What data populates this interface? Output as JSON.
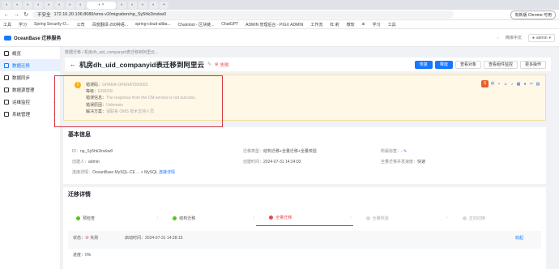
{
  "browser": {
    "address": "172.16.20.106:8089/oms-v2/migration/np_Sy5hk2invkw0",
    "not_secure": "不安全",
    "chrome_button": "有新版 Chrome 可用",
    "bookmarks": [
      "工具",
      "学习",
      "Spring Security-O...",
      "公司",
      "百度翻译-200种语...",
      "spring-cloud-aliba...",
      "Chaintool - 区块链...",
      "ChatGPT",
      "ADMIN 管理后台 - PIGX ADMIN",
      "工作流",
      "杠 莉",
      "微软",
      "ai",
      "学习",
      "工具"
    ]
  },
  "app": {
    "logo": "OceanBase 迁移服务",
    "lang": "简体中文",
    "user": "admin"
  },
  "sidebar": {
    "items": [
      {
        "label": "概览"
      },
      {
        "label": "数据迁移"
      },
      {
        "label": "数据同步"
      },
      {
        "label": "数据源管理"
      },
      {
        "label": "运维监控"
      },
      {
        "label": "系统管理"
      }
    ]
  },
  "page": {
    "breadcrumb": "数据迁移 / 机房dh_uid_companyid表迁移到阿里云...",
    "title": "机房dh_uid_companyid表迁移到阿里云",
    "status": "失败",
    "buttons": [
      "恢复",
      "释放",
      "查看对象",
      "查看组件监控",
      "更多操作"
    ]
  },
  "alert": {
    "code_label": "错误码：",
    "code": "GHANA-OPERAT000003",
    "level_label": "等级：",
    "level": "ERROR",
    "info_label": "错误信息：",
    "info": "The response from the CM service is not success.",
    "reason_label": "错误原因：",
    "reason": "Unknown",
    "solution_label": "解决方案：",
    "solution": "请联系 OMS 技术支持人员"
  },
  "basic": {
    "title": "基本信息",
    "id_label": "ID：",
    "id": "np_Sy5hk2invkw0",
    "type_label": "迁移类型：",
    "type": "结构迁移+全量迁移+全量校验",
    "tag_label": "所属标签：",
    "tag": "-",
    "creator_label": "创建人：",
    "creator": "admin",
    "created_label": "创建时间：",
    "created": "2024-07-31 14:24:03",
    "speed_label": "全量迁移并发速度：",
    "speed": "快速",
    "conn_label": "连接详情：",
    "conn_source": "OceanBase MySQL-CE ...",
    "conn_target": "MySQL",
    "conn_link": "连接详情"
  },
  "detail": {
    "title": "迁移详情",
    "steps": [
      {
        "label": "预检查",
        "state": "ok"
      },
      {
        "label": "结构迁移",
        "state": "ok"
      },
      {
        "label": "全量迁移",
        "state": "fail"
      },
      {
        "label": "全量校验",
        "state": "wait"
      },
      {
        "label": "正向切换",
        "state": "wait"
      }
    ],
    "status_label": "状态：",
    "status_value": "失败",
    "start_label": "启动时间：",
    "start_value": "2024-07-31 14:28:15",
    "progress_label": "进度：",
    "progress_value": "0%",
    "collapse": "收起"
  }
}
